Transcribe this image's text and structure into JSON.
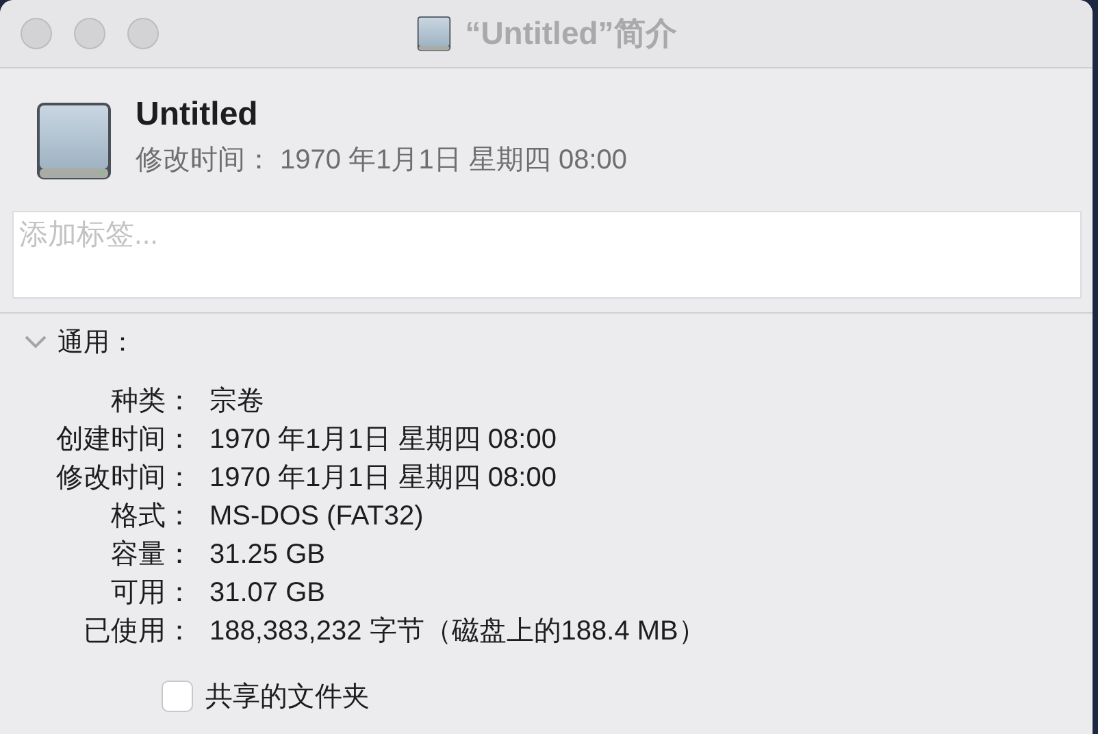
{
  "window": {
    "title": "“Untitled”简介"
  },
  "header": {
    "name": "Untitled",
    "modified": "修改时间： 1970 年1月1日 星期四 08:00"
  },
  "tags_field": {
    "placeholder": "添加标签..."
  },
  "general": {
    "title": "通用：",
    "expanded": true,
    "rows": [
      {
        "label": "种类：",
        "value": "宗卷"
      },
      {
        "label": "创建时间：",
        "value": "1970 年1月1日 星期四 08:00"
      },
      {
        "label": "修改时间：",
        "value": "1970 年1月1日 星期四 08:00"
      },
      {
        "label": "格式：",
        "value": "MS-DOS (FAT32)"
      },
      {
        "label": "容量：",
        "value": "31.25 GB"
      },
      {
        "label": "可用：",
        "value": "31.07 GB"
      },
      {
        "label": "已使用：",
        "value": "188,383,232 字节（磁盘上的188.4 MB）"
      }
    ],
    "shared_folder": {
      "label": "共享的文件夹",
      "checked": false
    }
  }
}
